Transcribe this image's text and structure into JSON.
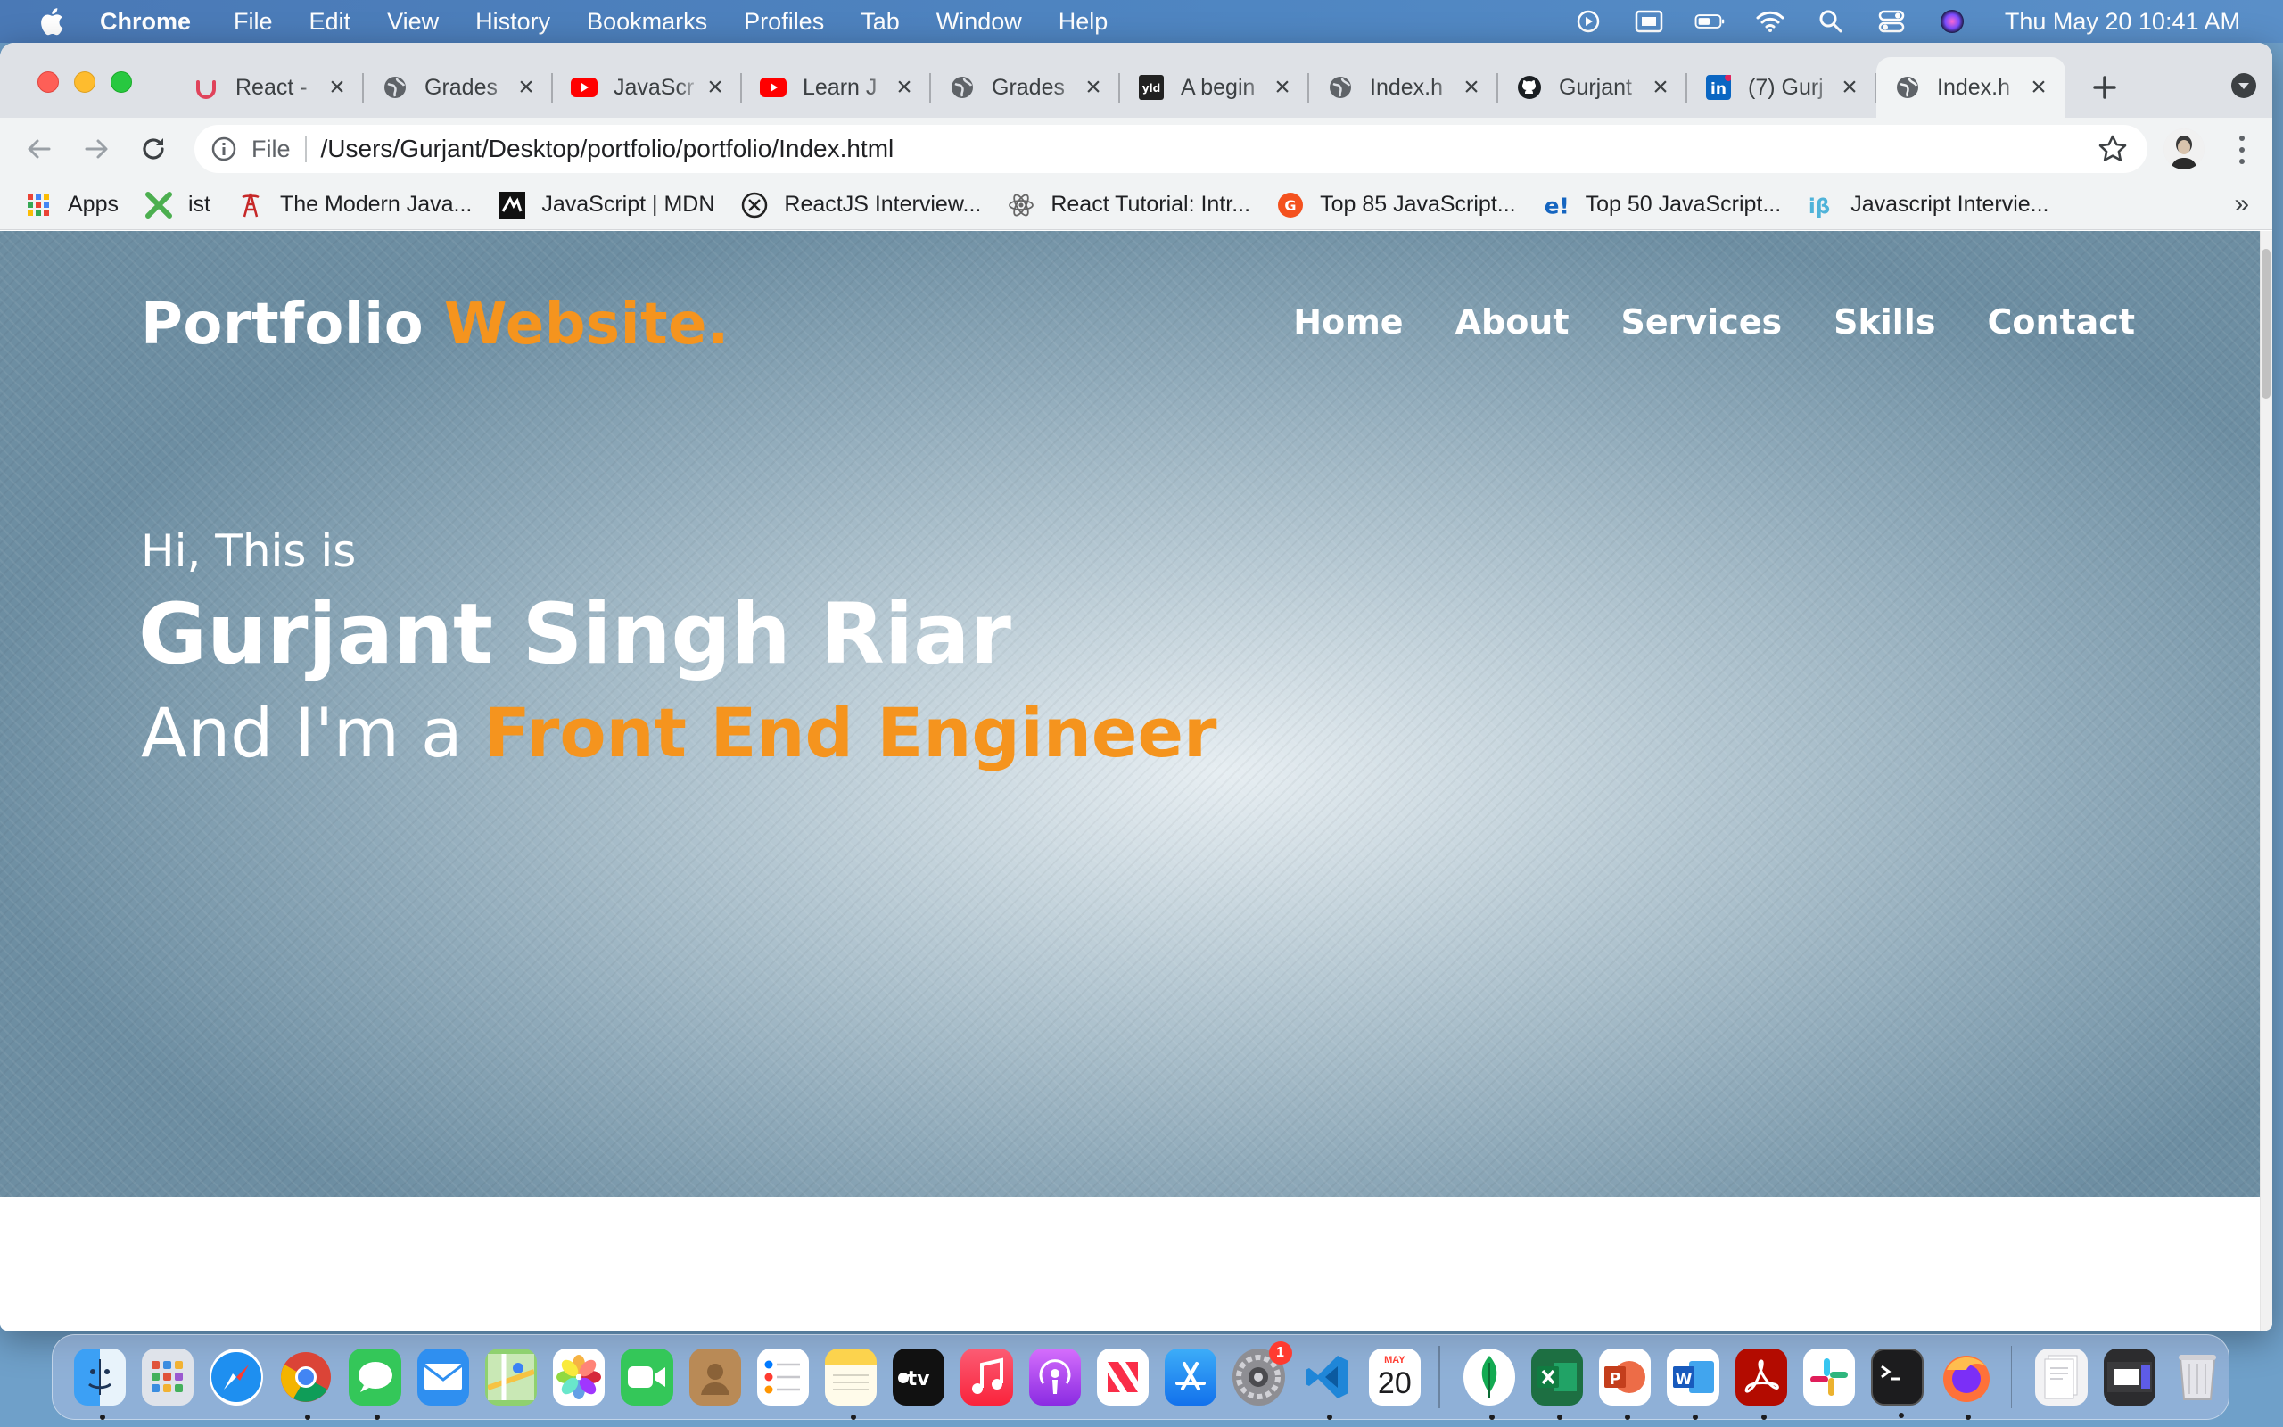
{
  "menubar": {
    "app_name": "Chrome",
    "menus": [
      "File",
      "Edit",
      "View",
      "History",
      "Bookmarks",
      "Profiles",
      "Tab",
      "Window",
      "Help"
    ],
    "status_icons": [
      "play-circle-icon",
      "screen-share-icon",
      "battery-icon",
      "wifi-icon",
      "spotlight-search-icon",
      "control-center-icon",
      "siri-icon"
    ],
    "clock": "Thu May 20  10:41 AM"
  },
  "tabs": [
    {
      "title": "React -",
      "icon": "udemy-icon"
    },
    {
      "title": "Grades",
      "icon": "globe-icon"
    },
    {
      "title": "JavaScr",
      "icon": "youtube-icon"
    },
    {
      "title": "Learn J",
      "icon": "youtube-icon"
    },
    {
      "title": "Grades",
      "icon": "globe-icon"
    },
    {
      "title": "A begin",
      "icon": "yld-icon"
    },
    {
      "title": "Index.h",
      "icon": "globe-icon"
    },
    {
      "title": "Gurjant",
      "icon": "github-icon"
    },
    {
      "title": "(7) Gurj",
      "icon": "linkedin-icon"
    },
    {
      "title": "Index.h",
      "icon": "globe-icon",
      "active": true
    }
  ],
  "toolbar": {
    "scheme_label": "File",
    "url": "/Users/Gurjant/Desktop/portfolio/portfolio/Index.html"
  },
  "bookmarks": [
    {
      "label": "Apps",
      "icon": "apps-grid-icon"
    },
    {
      "label": "ist",
      "icon": "x-logo-icon"
    },
    {
      "label": "The Modern Java...",
      "icon": "tower-icon"
    },
    {
      "label": "JavaScript | MDN",
      "icon": "mdn-icon"
    },
    {
      "label": "ReactJS Interview...",
      "icon": "x-circle-icon"
    },
    {
      "label": "React Tutorial: Intr...",
      "icon": "react-icon"
    },
    {
      "label": "Top 85 JavaScript...",
      "icon": "orange-circle-icon"
    },
    {
      "label": "Top 50 JavaScript...",
      "icon": "edureka-icon"
    },
    {
      "label": "Javascript Intervie...",
      "icon": "ib-icon"
    }
  ],
  "bookmarks_more": "»",
  "page": {
    "brand_main": "Portfolio",
    "brand_accent": "Website.",
    "nav": [
      "Home",
      "About",
      "Services",
      "Skills",
      "Contact"
    ],
    "greeting": "Hi, This is",
    "name": "Gurjant Singh Riar",
    "role_prefix": "And I'm a",
    "role_accent": "Front End Engineer"
  },
  "dock": {
    "calendar_month": "MAY",
    "calendar_day": "20",
    "settings_badge": "1",
    "apps": [
      "finder",
      "launchpad",
      "safari",
      "chrome",
      "messages",
      "mail",
      "maps",
      "photos",
      "facetime",
      "contacts",
      "reminders",
      "notes",
      "apple-tv",
      "music",
      "podcasts",
      "news",
      "app-store",
      "system-preferences",
      "vscode",
      "calendar",
      "mongodb-compass",
      "excel",
      "powerpoint",
      "word",
      "acrobat",
      "slack",
      "terminal",
      "firefox",
      "downloads",
      "screenshots",
      "trash"
    ]
  },
  "colors": {
    "accent_orange": "#f5941e",
    "menubar_blue": "#4f86c2"
  }
}
